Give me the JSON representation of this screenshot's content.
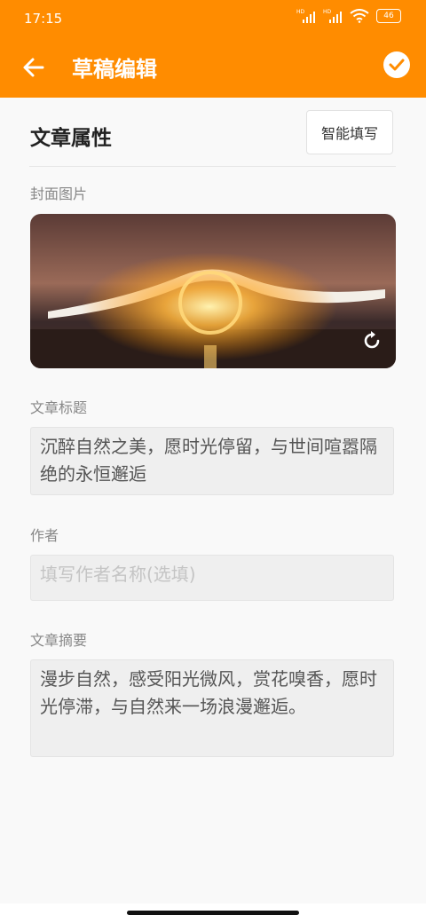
{
  "status_bar": {
    "time": "17:15",
    "network_1": "HD",
    "network_2": "HD",
    "battery": "46"
  },
  "toolbar": {
    "title": "草稿编辑",
    "back_icon": "back-arrow-icon",
    "confirm_icon": "check-circle-icon"
  },
  "section": {
    "title": "文章属性",
    "smart_fill_label": "智能填写"
  },
  "cover": {
    "label": "封面图片",
    "refresh_icon": "refresh-icon"
  },
  "article_title": {
    "label": "文章标题",
    "value": "沉醉自然之美，愿时光停留，与世间喧嚣隔绝的永恒邂逅"
  },
  "author": {
    "label": "作者",
    "value": "",
    "placeholder": "填写作者名称(选填)"
  },
  "summary": {
    "label": "文章摘要",
    "value": "漫步自然，感受阳光微风，赏花嗅香，愿时光停滞，与自然来一场浪漫邂逅。"
  },
  "colors": {
    "accent": "#ff8c00",
    "background": "#f9f9f9"
  }
}
